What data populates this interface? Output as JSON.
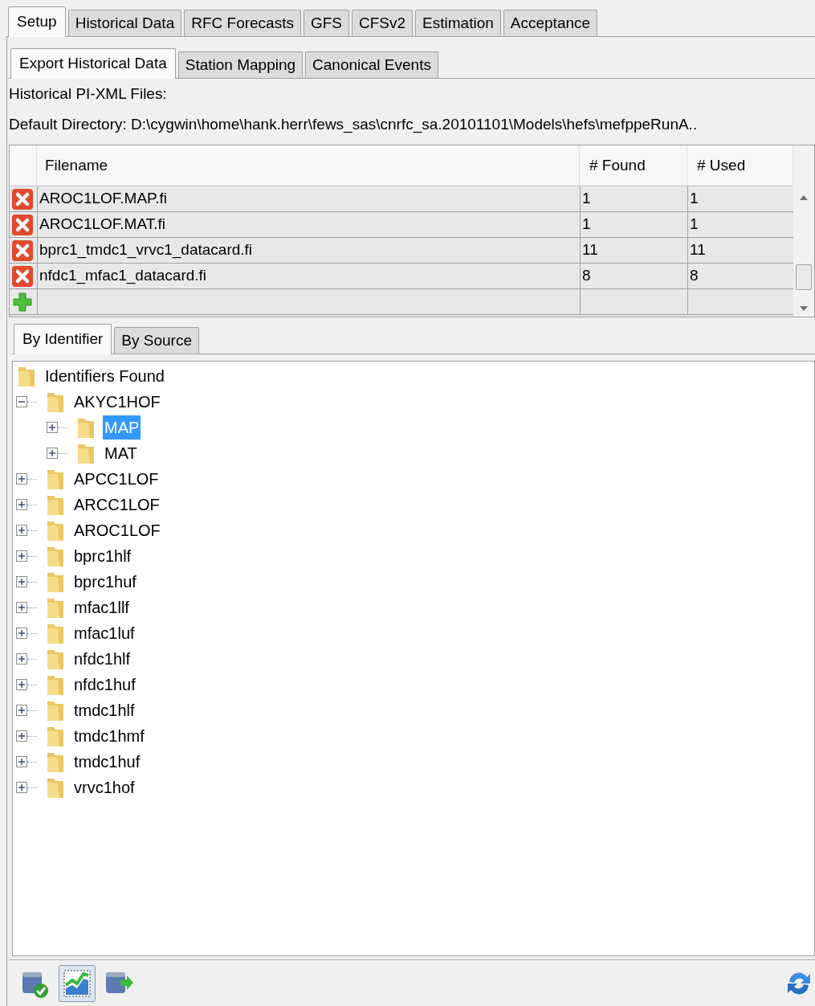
{
  "tabs": [
    {
      "label": "Setup",
      "selected": true
    },
    {
      "label": "Historical Data",
      "selected": false
    },
    {
      "label": "RFC Forecasts",
      "selected": false
    },
    {
      "label": "GFS",
      "selected": false
    },
    {
      "label": "CFSv2",
      "selected": false
    },
    {
      "label": "Estimation",
      "selected": false
    },
    {
      "label": "Acceptance",
      "selected": false
    }
  ],
  "subtabs": [
    {
      "label": "Export Historical Data",
      "selected": true
    },
    {
      "label": "Station Mapping",
      "selected": false
    },
    {
      "label": "Canonical Events",
      "selected": false
    }
  ],
  "section_label": "Historical PI-XML Files:",
  "default_directory": "Default Directory: D:\\cygwin\\home\\hank.herr\\fews_sas\\cnrfc_sa.20101101\\Models\\hefs\\mefppeRunA..",
  "table": {
    "columns": [
      "Filename",
      "# Found",
      "# Used"
    ],
    "rows": [
      {
        "kind": "file",
        "cells": [
          "AROC1LOF.MAP.fi",
          "1",
          "1"
        ]
      },
      {
        "kind": "file",
        "cells": [
          "AROC1LOF.MAT.fi",
          "1",
          "1"
        ]
      },
      {
        "kind": "file",
        "cells": [
          "bprc1_tmdc1_vrvc1_datacard.fi",
          "11",
          "11"
        ]
      },
      {
        "kind": "file",
        "cells": [
          "nfdc1_mfac1_datacard.fi",
          "8",
          "8"
        ]
      },
      {
        "kind": "add",
        "cells": [
          "",
          "",
          ""
        ]
      }
    ]
  },
  "view_tabs": [
    {
      "label": "By Identifier",
      "selected": true
    },
    {
      "label": "By Source",
      "selected": false
    }
  ],
  "tree": {
    "label": "Identifiers Found",
    "children": [
      {
        "label": "AKYC1HOF",
        "expanded": true,
        "selected": false,
        "children": [
          {
            "label": "MAP",
            "expanded": false,
            "selected": true
          },
          {
            "label": "MAT",
            "expanded": false,
            "selected": false
          }
        ]
      },
      {
        "label": "APCC1LOF",
        "expanded": false,
        "selected": false
      },
      {
        "label": "ARCC1LOF",
        "expanded": false,
        "selected": false
      },
      {
        "label": "AROC1LOF",
        "expanded": false,
        "selected": false
      },
      {
        "label": "bprc1hlf",
        "expanded": false,
        "selected": false
      },
      {
        "label": "bprc1huf",
        "expanded": false,
        "selected": false
      },
      {
        "label": "mfac1llf",
        "expanded": false,
        "selected": false
      },
      {
        "label": "mfac1luf",
        "expanded": false,
        "selected": false
      },
      {
        "label": "nfdc1hlf",
        "expanded": false,
        "selected": false
      },
      {
        "label": "nfdc1huf",
        "expanded": false,
        "selected": false
      },
      {
        "label": "tmdc1hlf",
        "expanded": false,
        "selected": false
      },
      {
        "label": "tmdc1hmf",
        "expanded": false,
        "selected": false
      },
      {
        "label": "tmdc1huf",
        "expanded": false,
        "selected": false
      },
      {
        "label": "vrvc1hof",
        "expanded": false,
        "selected": false
      }
    ]
  },
  "toolbar": [
    {
      "kind": "db-check",
      "selected": false
    },
    {
      "kind": "chart",
      "selected": true
    },
    {
      "kind": "db-export",
      "selected": false
    }
  ]
}
